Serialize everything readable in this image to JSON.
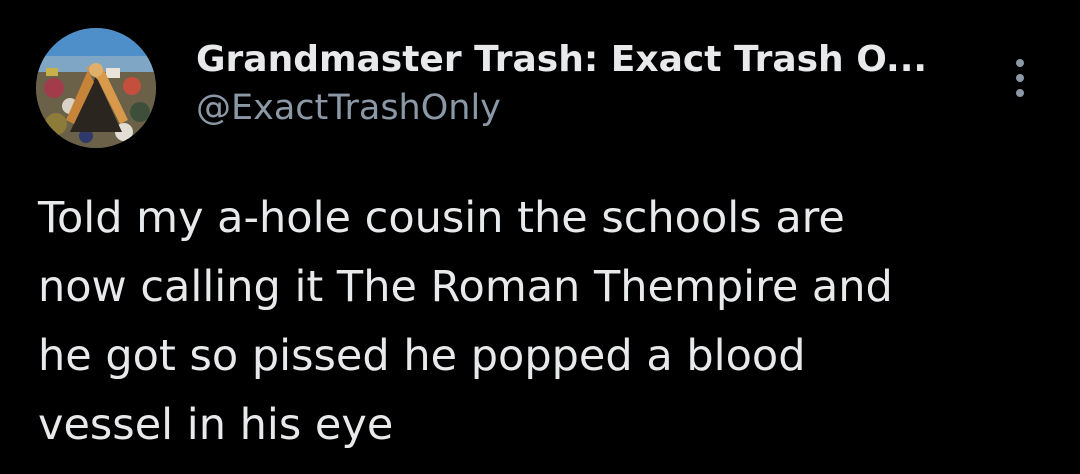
{
  "author": {
    "display_name": "Grandmaster Trash: Exact Trash O...",
    "handle": "@ExactTrashOnly",
    "avatar_icon": "trash-pile-avatar-icon"
  },
  "menu": {
    "more_icon": "more-vertical-icon"
  },
  "tweet": {
    "lines": [
      "Told my a-hole cousin the schools are",
      "now calling it The Roman Thempire and",
      "he got so pissed he popped a blood",
      "vessel in his eye"
    ]
  },
  "colors": {
    "background": "#000000",
    "primary_text": "#e7e9ea",
    "secondary_text": "#8b98a5"
  }
}
